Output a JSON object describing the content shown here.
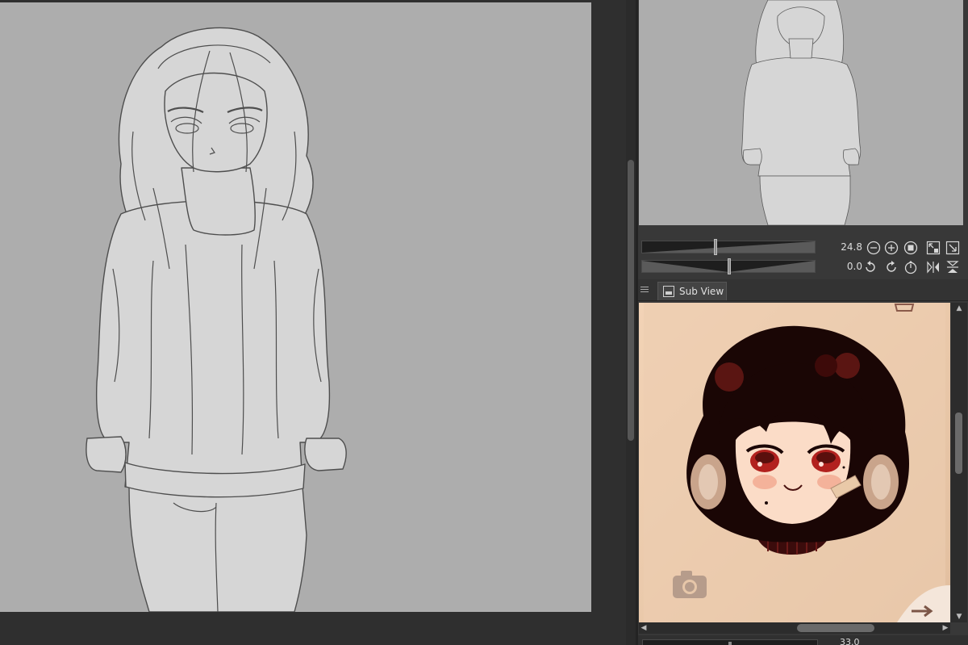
{
  "canvas": {
    "description_free": true,
    "background_color": "#adadad",
    "line_color": "#4a4a4a",
    "skin_color": "#d8d8d8"
  },
  "navigator": {
    "zoom_value": "24.8",
    "rotate_value": "0.0",
    "zoom_level_fraction": 0.42,
    "rotate_level_fraction": 0.5,
    "buttons": {
      "zoom_out": "zoom-out-icon",
      "zoom_in": "zoom-in-icon",
      "stop": "stop-icon",
      "fit": "fit-window-icon",
      "actual": "actual-size-icon",
      "rotate_left": "rotate-left-icon",
      "rotate_right": "rotate-right-icon",
      "reset_rotate": "reset-rotation-icon",
      "flip_h": "flip-horizontal-icon",
      "flip_v": "flip-vertical-icon"
    }
  },
  "subview": {
    "tab_label": "Sub View",
    "background_color": "#e7c7a9",
    "hair_color": "#1a0605",
    "eye_color": "#b2211e",
    "skin_color": "#fbdcc7",
    "bottom_value": "33.0"
  }
}
